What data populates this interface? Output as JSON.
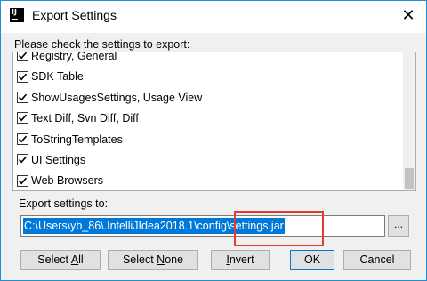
{
  "window": {
    "title": "Export Settings",
    "close_glyph": "✕",
    "app_icon": "intellij-icon",
    "app_icon_text": "IJ"
  },
  "instruction": "Please check the settings to export:",
  "settings_list": [
    {
      "label": "Registry, General",
      "checked": true
    },
    {
      "label": "SDK Table",
      "checked": true
    },
    {
      "label": "ShowUsagesSettings, Usage View",
      "checked": true
    },
    {
      "label": "Text Diff, Svn Diff, Diff",
      "checked": true
    },
    {
      "label": "ToStringTemplates",
      "checked": true
    },
    {
      "label": "UI Settings",
      "checked": true
    },
    {
      "label": "Web Browsers",
      "checked": true
    }
  ],
  "export": {
    "label": "Export settings to:",
    "path_value": "C:\\Users\\yb_86\\.IntelliJIdea2018.1\\config\\settings.jar",
    "browse_label": "..."
  },
  "buttons": {
    "select_all_pre": "Select ",
    "select_all_key": "A",
    "select_all_post": "ll",
    "select_none_pre": "Select ",
    "select_none_key": "N",
    "select_none_post": "one",
    "invert_key": "I",
    "invert_post": "nvert",
    "ok": "OK",
    "cancel": "Cancel"
  },
  "colors": {
    "accent": "#0078d7",
    "highlight_annotation": "#e53935",
    "window_border": "#1e8fd6"
  }
}
